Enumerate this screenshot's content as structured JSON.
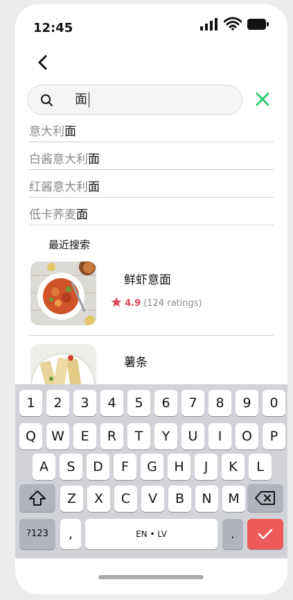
{
  "status_bar": {
    "time": "12:45"
  },
  "search": {
    "query": "面"
  },
  "suggestions": [
    {
      "prefix": "意大利",
      "match": "面"
    },
    {
      "prefix": "白酱意大利",
      "match": "面"
    },
    {
      "prefix": "红酱意大利",
      "match": "面"
    },
    {
      "prefix": "低卡荞麦",
      "match": "面"
    }
  ],
  "recent": {
    "title": "最近搜索",
    "items": [
      {
        "name": "鲜虾意面",
        "rating": "4.9",
        "rating_count": "(124 ratings)"
      },
      {
        "name": "薯条"
      }
    ]
  },
  "keyboard": {
    "row1": [
      "1",
      "2",
      "3",
      "4",
      "5",
      "6",
      "7",
      "8",
      "9",
      "0"
    ],
    "row2": [
      "Q",
      "W",
      "E",
      "R",
      "T",
      "Y",
      "U",
      "I",
      "O",
      "P"
    ],
    "row3": [
      "A",
      "S",
      "D",
      "F",
      "G",
      "H",
      "J",
      "K",
      "L"
    ],
    "row4": [
      "Z",
      "X",
      "C",
      "V",
      "B",
      "N",
      "M"
    ],
    "numbers_label": "?123",
    "comma_label": ",",
    "space_label": "EN • LV",
    "period_label": ".",
    "colors": {
      "enter": "#ef5b5b",
      "accent": "#2ecc71",
      "star": "#e0455a"
    }
  }
}
